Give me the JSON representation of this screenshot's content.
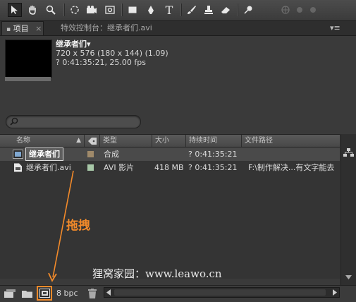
{
  "toolbar": {
    "tools": [
      "selection-tool",
      "hand-tool",
      "zoom-tool",
      "rotate-tool",
      "camera-tool",
      "pan-behind-tool",
      "rectangle-tool",
      "pen-tool",
      "type-tool",
      "brush-tool",
      "clone-stamp-tool",
      "eraser-tool",
      "puppet-pin-tool"
    ],
    "type_tool_glyph": "T"
  },
  "tabs": {
    "project": "项目",
    "project_close": "×",
    "effect_controls": "特效控制台：继承者们.avi",
    "menu_glyph": "▾≡"
  },
  "preview": {
    "name": "继承者们▾",
    "resolution": "720 x 576  (180 x 144) (1.09)",
    "duration_fps": "? 0:41:35:21, 25.00 fps"
  },
  "search": {
    "placeholder": ""
  },
  "columns": {
    "name": "名称",
    "type": "类型",
    "size": "大小",
    "duration": "持续时间",
    "path": "文件路径"
  },
  "items": [
    {
      "name": "继承者们",
      "color": "#a08a6a",
      "type": "合成",
      "size": "",
      "duration": "? 0:41:35:21",
      "path": ""
    },
    {
      "name": "继承者们.avi",
      "color": "#a8c8a8",
      "type": "AVI 影片",
      "size": "418 MB",
      "duration": "? 0:41:35:21",
      "path": "F:\\制作解决...有文字能去"
    }
  ],
  "bottom": {
    "bpc": "8 bpc"
  },
  "annotations": {
    "drag_label": "拖拽",
    "watermark": "狸窝家园：www.leawo.cn",
    "accent": "#f28a2a"
  }
}
